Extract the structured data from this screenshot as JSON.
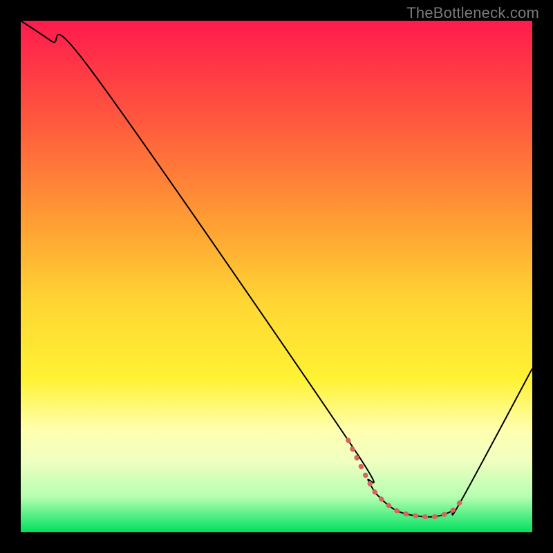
{
  "watermark": "TheBottleneck.com",
  "chart_data": {
    "type": "line",
    "title": "",
    "xlabel": "",
    "ylabel": "",
    "xlim": [
      0,
      100
    ],
    "ylim": [
      0,
      100
    ],
    "series": [
      {
        "name": "curve",
        "color": "#000000",
        "width": 2,
        "x": [
          0,
          6,
          14,
          64,
          68,
          70,
          74,
          80,
          84,
          86,
          100
        ],
        "values": [
          100,
          96,
          90,
          18,
          10,
          7,
          4,
          3,
          4,
          6,
          32
        ]
      },
      {
        "name": "highlight",
        "color": "#d9655a",
        "width": 7,
        "dash": "1 13",
        "cap": "round",
        "x": [
          64,
          68,
          70,
          74,
          80,
          84,
          86
        ],
        "values": [
          18,
          10,
          7,
          4,
          3,
          4,
          6
        ]
      }
    ]
  }
}
